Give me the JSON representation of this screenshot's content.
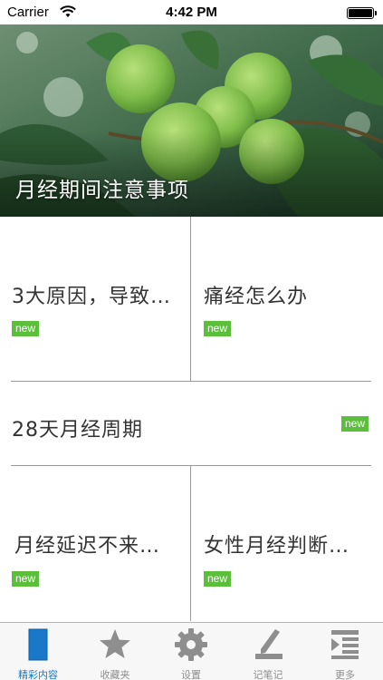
{
  "status_bar": {
    "carrier": "Carrier",
    "time": "4:42 PM"
  },
  "hero": {
    "title": "月经期间注意事项"
  },
  "cards": [
    {
      "title": "3大原因，导致…",
      "badge": "new"
    },
    {
      "title": "痛经怎么办",
      "badge": "new"
    },
    {
      "title": "28天月经周期",
      "badge": "new"
    },
    {
      "title": "月经延迟不来…",
      "badge": "new"
    },
    {
      "title": "女性月经判断…",
      "badge": "new"
    }
  ],
  "tabs": [
    {
      "label": "精彩内容",
      "icon": "document-icon",
      "active": true
    },
    {
      "label": "收藏夹",
      "icon": "star-icon",
      "active": false
    },
    {
      "label": "设置",
      "icon": "gear-icon",
      "active": false
    },
    {
      "label": "记笔记",
      "icon": "pen-icon",
      "active": false
    },
    {
      "label": "更多",
      "icon": "more-list-icon",
      "active": false
    }
  ],
  "colors": {
    "accent": "#1978c8",
    "badge": "#5cbf3b",
    "inactive": "#8e8e8e"
  }
}
